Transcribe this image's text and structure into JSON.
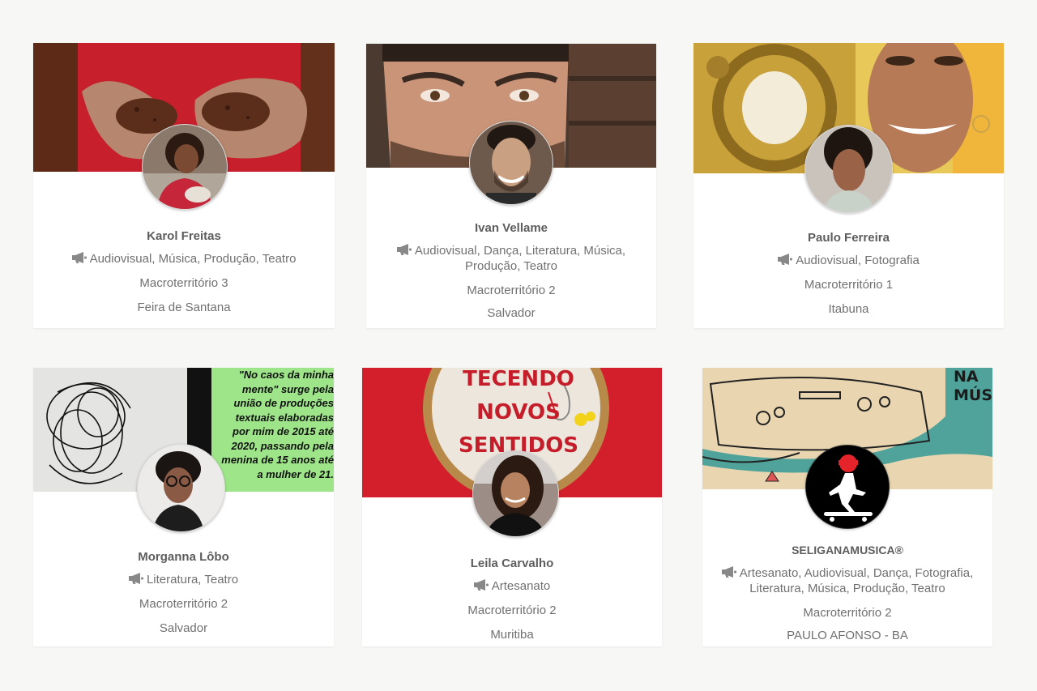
{
  "profiles": [
    {
      "name": "Karol Freitas",
      "areas": "Audiovisual, Música, Produção, Teatro",
      "macro": "Macroterritório 3",
      "city": "Feira de Santana"
    },
    {
      "name": "Ivan Vellame",
      "areas": "Audiovisual, Dança, Literatura, Música, Produção, Teatro",
      "macro": "Macroterritório 2",
      "city": "Salvador"
    },
    {
      "name": "Paulo Ferreira",
      "areas": "Audiovisual, Fotografia",
      "macro": "Macroterritório 1",
      "city": "Itabuna"
    },
    {
      "name": "Morganna Lôbo",
      "areas": "Literatura, Teatro",
      "macro": "Macroterritório 2",
      "city": "Salvador"
    },
    {
      "name": "Leila Carvalho",
      "areas": "Artesanato",
      "macro": "Macroterritório 2",
      "city": "Muritiba"
    },
    {
      "name": "SELIGANAMUSICA®",
      "areas": "Artesanato, Audiovisual, Dança, Fotografia, Literatura, Música, Produção, Teatro",
      "macro": "Macroterritório 2",
      "city": "PAULO AFONSO - BA"
    }
  ],
  "banners": {
    "poem": [
      "\"No caos da minha",
      "mente\" surge pela",
      "união de produções",
      "textuais elaboradas",
      "por mim de 2015 até",
      "2020, passando pela",
      "menina de 15 anos até",
      "a mulher de 21."
    ],
    "embroidery": [
      "TECENDO",
      "NOVOS",
      "SENTIDOS"
    ],
    "music": [
      "NA",
      "MÚSICA"
    ]
  },
  "icons": {
    "area_icon": "megaphone-icon"
  },
  "colors": {
    "text": "#707070",
    "name": "#5d5d5d",
    "icon": "#888888"
  }
}
